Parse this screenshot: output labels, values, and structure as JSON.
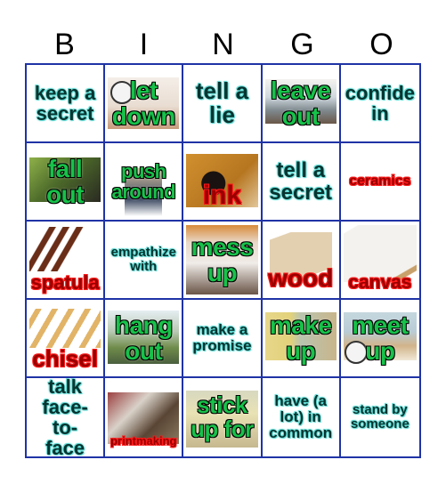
{
  "title_letters": [
    "B",
    "I",
    "N",
    "G",
    "O"
  ],
  "colors": {
    "grid_line": "#1f33a6",
    "teal_text": "#08332f",
    "teal_glow": "#4fd6d0",
    "green_text": "#17c24a",
    "red_text": "#9a0000",
    "red_outline": "#ff1a1a"
  },
  "cells": [
    {
      "label": "keep a secret",
      "style": "teal",
      "image": null
    },
    {
      "label": "let down",
      "style": "green",
      "image": "clock-and-dinner-table-scene"
    },
    {
      "label": "tell a lie",
      "style": "teal",
      "image": null
    },
    {
      "label": "leave out",
      "style": "green",
      "image": "kids-playing-photo"
    },
    {
      "label": "confide in",
      "style": "teal",
      "image": null
    },
    {
      "label": "fall out",
      "style": "green",
      "image": "park-bench-couple-photo"
    },
    {
      "label": "push around",
      "style": "green",
      "image": "cartoon-bully"
    },
    {
      "label": "ink",
      "style": "red",
      "image": "ink-bottle-photo"
    },
    {
      "label": "tell a secret",
      "style": "teal",
      "image": null
    },
    {
      "label": "ceramics",
      "style": "red",
      "image": null
    },
    {
      "label": "spatula",
      "style": "red",
      "image": "palette-knives-photo"
    },
    {
      "label": "empathize with",
      "style": "teal",
      "image": null
    },
    {
      "label": "mess up",
      "style": "green",
      "image": "cat-mess-photo"
    },
    {
      "label": "wood",
      "style": "red",
      "image": "wood-panels-photo"
    },
    {
      "label": "canvas",
      "style": "red",
      "image": "canvas-photo"
    },
    {
      "label": "chisel",
      "style": "red",
      "image": "chisel-set-photo"
    },
    {
      "label": "hang out",
      "style": "green",
      "image": "friends-outdoors-photo"
    },
    {
      "label": "make a promise",
      "style": "teal",
      "image": null
    },
    {
      "label": "make up",
      "style": "green",
      "image": "cartoon-couple"
    },
    {
      "label": "meet up",
      "style": "green",
      "image": "clock-and-cinema-cartoon"
    },
    {
      "label": "talk face-to-face",
      "style": "teal",
      "image": null
    },
    {
      "label": "printmaking",
      "style": "red",
      "image": "printmaking-studio-photo"
    },
    {
      "label": "stick up for",
      "style": "green",
      "image": "cartoon-classroom"
    },
    {
      "label": "have (a lot) in common",
      "style": "teal",
      "image": null
    },
    {
      "label": "stand by someone",
      "style": "teal",
      "image": null
    }
  ]
}
